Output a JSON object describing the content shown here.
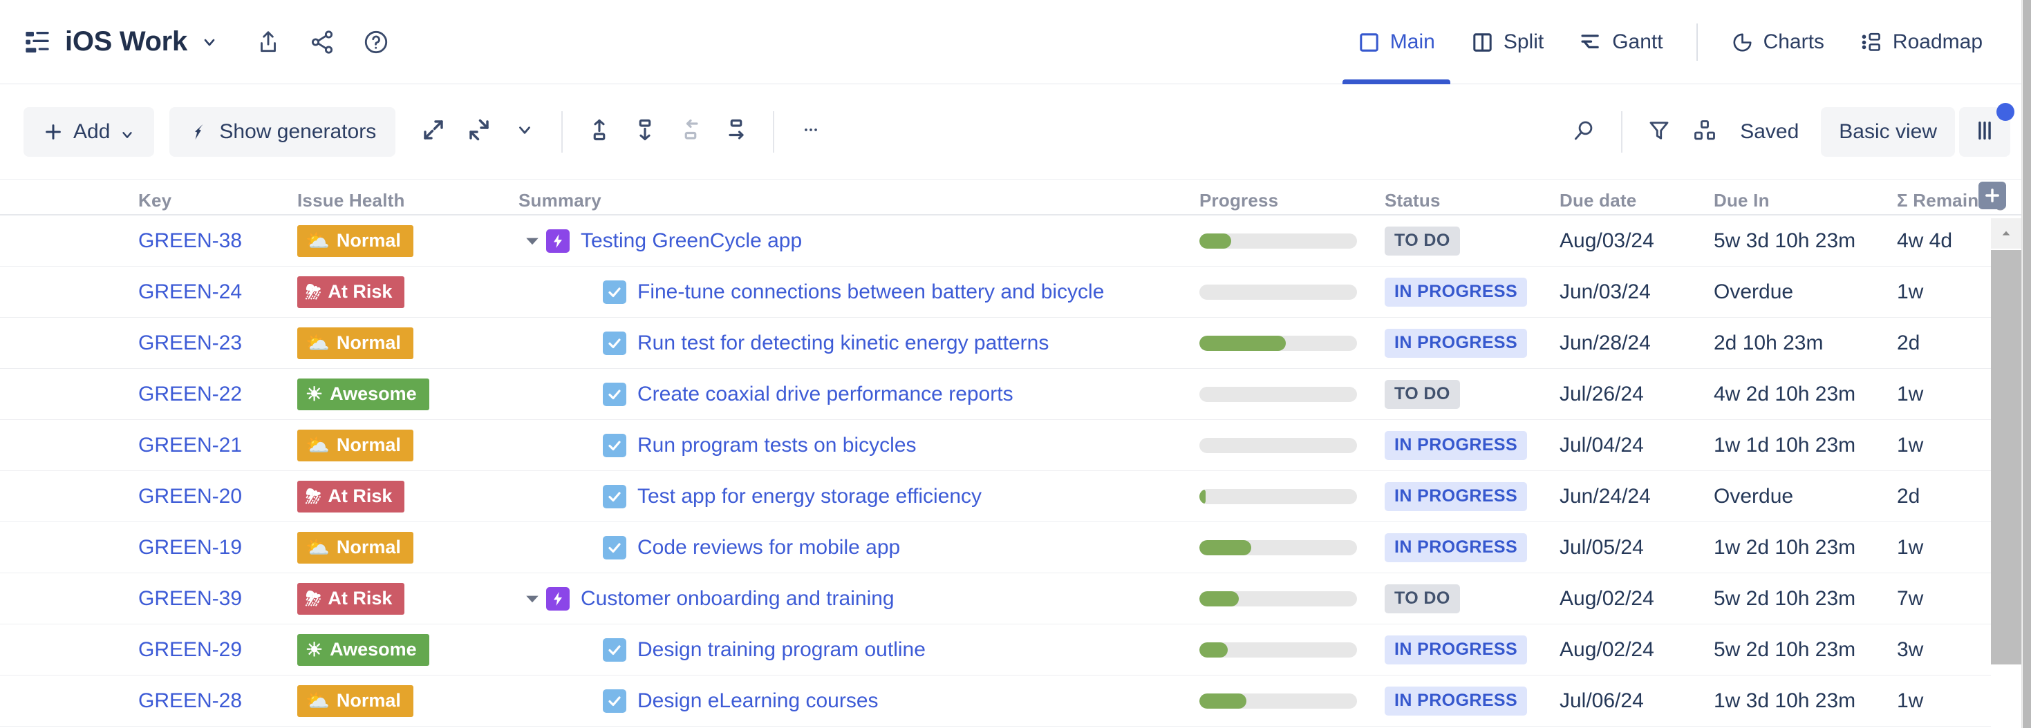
{
  "header": {
    "board_title": "iOS Work",
    "board_icon": "board-icon",
    "caret": "chevron-down-icon",
    "actions": [
      {
        "name": "export-icon",
        "label": "Export"
      },
      {
        "name": "share-icon",
        "label": "Share"
      },
      {
        "name": "help-icon",
        "label": "Help"
      }
    ],
    "nav": [
      {
        "label": "Main",
        "icon": "main-view-icon",
        "active": true
      },
      {
        "label": "Split",
        "icon": "split-view-icon",
        "active": false
      },
      {
        "label": "Gantt",
        "icon": "gantt-view-icon",
        "active": false
      },
      {
        "label": "Charts",
        "icon": "charts-view-icon",
        "active": false
      },
      {
        "label": "Roadmap",
        "icon": "roadmap-view-icon",
        "active": false
      }
    ]
  },
  "toolbar": {
    "add_label": "Add",
    "show_generators_label": "Show generators",
    "icons": [
      {
        "name": "expand-all-icon"
      },
      {
        "name": "collapse-all-icon"
      },
      {
        "name": "expand-level-caret-icon"
      },
      {
        "name": "move-up-icon"
      },
      {
        "name": "move-down-icon"
      },
      {
        "name": "outdent-icon"
      },
      {
        "name": "indent-icon"
      },
      {
        "name": "more-options-icon"
      }
    ],
    "search_icon": "search-icon",
    "filter_icon": "filter-icon",
    "group-icon": "group-by-icon",
    "saved_label": "Saved",
    "basic_view_label": "Basic view",
    "columns_icon": "columns-icon",
    "columns_badge_color": "#3F63E3"
  },
  "grid": {
    "columns": [
      "Key",
      "Issue Health",
      "Summary",
      "Progress",
      "Status",
      "Due date",
      "Due In",
      "Σ Remaining"
    ],
    "add_column_icon": "add-column-icon",
    "rows": [
      {
        "key": "GREEN-38",
        "health": "Normal",
        "health_style": "normal",
        "health_emoji": "⛅",
        "level": 0,
        "expandable": true,
        "type": "epic",
        "summary": "Testing GreenCycle app",
        "progress": 20,
        "status": "TO DO",
        "status_style": "todo",
        "due_date": "Aug/03/24",
        "due_in": "5w 3d 10h 23m",
        "remaining": "4w 4d"
      },
      {
        "key": "GREEN-24",
        "health": "At Risk",
        "health_style": "atrisk",
        "health_emoji": "⛈",
        "level": 1,
        "expandable": false,
        "type": "task",
        "summary": "Fine-tune connections between battery and bicycle",
        "progress": 0,
        "status": "IN PROGRESS",
        "status_style": "inprog",
        "due_date": "Jun/03/24",
        "due_in": "Overdue",
        "remaining": "1w"
      },
      {
        "key": "GREEN-23",
        "health": "Normal",
        "health_style": "normal",
        "health_emoji": "⛅",
        "level": 1,
        "expandable": false,
        "type": "task",
        "summary": "Run test for detecting kinetic energy patterns",
        "progress": 55,
        "status": "IN PROGRESS",
        "status_style": "inprog",
        "due_date": "Jun/28/24",
        "due_in": "2d 10h 23m",
        "remaining": "2d"
      },
      {
        "key": "GREEN-22",
        "health": "Awesome",
        "health_style": "awesome",
        "health_emoji": "☀",
        "level": 1,
        "expandable": false,
        "type": "task",
        "summary": "Create coaxial drive performance reports",
        "progress": 0,
        "status": "TO DO",
        "status_style": "todo",
        "due_date": "Jul/26/24",
        "due_in": "4w 2d 10h 23m",
        "remaining": "1w"
      },
      {
        "key": "GREEN-21",
        "health": "Normal",
        "health_style": "normal",
        "health_emoji": "⛅",
        "level": 1,
        "expandable": false,
        "type": "task",
        "summary": "Run program tests on bicycles",
        "progress": 0,
        "status": "IN PROGRESS",
        "status_style": "inprog",
        "due_date": "Jul/04/24",
        "due_in": "1w 1d 10h 23m",
        "remaining": "1w"
      },
      {
        "key": "GREEN-20",
        "health": "At Risk",
        "health_style": "atrisk",
        "health_emoji": "⛈",
        "level": 1,
        "expandable": false,
        "type": "task",
        "summary": "Test app for energy storage efficiency",
        "progress": 4,
        "status": "IN PROGRESS",
        "status_style": "inprog",
        "due_date": "Jun/24/24",
        "due_in": "Overdue",
        "remaining": "2d"
      },
      {
        "key": "GREEN-19",
        "health": "Normal",
        "health_style": "normal",
        "health_emoji": "⛅",
        "level": 1,
        "expandable": false,
        "type": "task",
        "summary": "Code reviews for mobile app",
        "progress": 33,
        "status": "IN PROGRESS",
        "status_style": "inprog",
        "due_date": "Jul/05/24",
        "due_in": "1w 2d 10h 23m",
        "remaining": "1w"
      },
      {
        "key": "GREEN-39",
        "health": "At Risk",
        "health_style": "atrisk",
        "health_emoji": "⛈",
        "level": 0,
        "expandable": true,
        "type": "epic",
        "summary": "Customer onboarding and training",
        "progress": 25,
        "status": "TO DO",
        "status_style": "todo",
        "due_date": "Aug/02/24",
        "due_in": "5w 2d 10h 23m",
        "remaining": "7w"
      },
      {
        "key": "GREEN-29",
        "health": "Awesome",
        "health_style": "awesome",
        "health_emoji": "☀",
        "level": 1,
        "expandable": false,
        "type": "task",
        "summary": "Design training program outline",
        "progress": 18,
        "status": "IN PROGRESS",
        "status_style": "inprog",
        "due_date": "Aug/02/24",
        "due_in": "5w 2d 10h 23m",
        "remaining": "3w"
      },
      {
        "key": "GREEN-28",
        "health": "Normal",
        "health_style": "normal",
        "health_emoji": "⛅",
        "level": 1,
        "expandable": false,
        "type": "task",
        "summary": "Design eLearning courses",
        "progress": 30,
        "status": "IN PROGRESS",
        "status_style": "inprog",
        "due_date": "Jul/06/24",
        "due_in": "1w 3d 10h 23m",
        "remaining": "1w"
      }
    ]
  },
  "colors": {
    "health_normal": "#E5A42B",
    "health_atrisk": "#CC5A66",
    "health_awesome": "#64A84F",
    "progress_fill": "#7FAB58",
    "link": "#3D5BD6",
    "accent": "#3658CE"
  }
}
